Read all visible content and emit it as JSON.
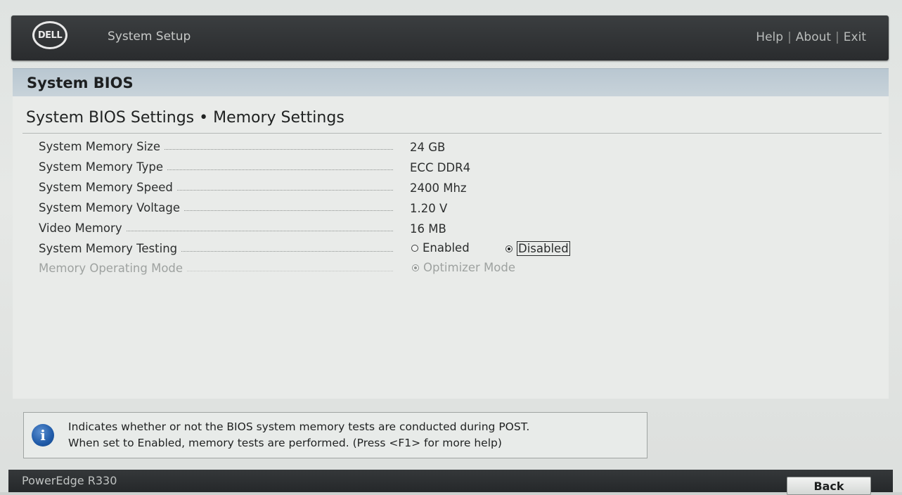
{
  "header": {
    "logo_text": "DELL",
    "app_title": "System Setup",
    "links": {
      "help": "Help",
      "about": "About",
      "exit": "Exit",
      "separator": "|"
    }
  },
  "section": {
    "title": "System BIOS"
  },
  "page": {
    "title": "System BIOS Settings • Memory Settings"
  },
  "settings": {
    "memory_size": {
      "label": "System Memory Size",
      "value": "24 GB"
    },
    "memory_type": {
      "label": "System Memory Type",
      "value": "ECC DDR4"
    },
    "memory_speed": {
      "label": "System Memory Speed",
      "value": "2400 Mhz"
    },
    "memory_voltage": {
      "label": "System Memory Voltage",
      "value": "1.20 V"
    },
    "video_memory": {
      "label": "Video Memory",
      "value": "16 MB"
    },
    "memory_testing": {
      "label": "System Memory Testing",
      "options": [
        "Enabled",
        "Disabled"
      ],
      "selected": "Disabled"
    },
    "operating_mode": {
      "label": "Memory Operating Mode",
      "options": [
        "Optimizer Mode"
      ],
      "selected": "Optimizer Mode",
      "disabled": true
    }
  },
  "help": {
    "icon": "info-icon",
    "line1": "Indicates whether or not the BIOS system memory tests are conducted during POST.",
    "line2": "When set to Enabled, memory tests are performed. (Press <F1> for more help)"
  },
  "footer": {
    "model": "PowerEdge R330",
    "back_label": "Back"
  },
  "colors": {
    "header_bg": "#2f3234",
    "band_bg": "#c0ccd4",
    "info_blue": "#1f5aa8"
  }
}
